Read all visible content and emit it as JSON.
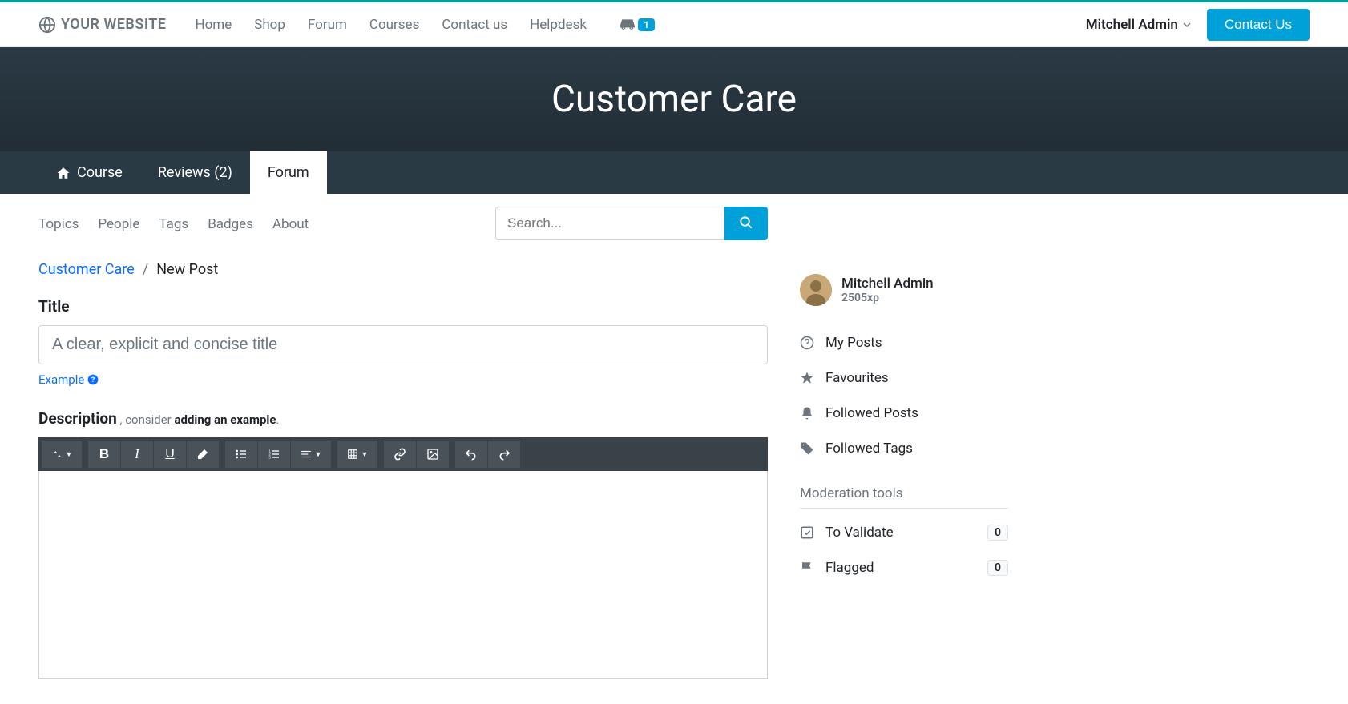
{
  "header": {
    "logo_text": "YOUR WEBSITE",
    "nav": [
      "Home",
      "Shop",
      "Forum",
      "Courses",
      "Contact us",
      "Helpdesk"
    ],
    "cart_count": "1",
    "user_name": "Mitchell Admin",
    "contact_btn": "Contact Us"
  },
  "hero": {
    "title": "Customer Care"
  },
  "subtabs": {
    "course": "Course",
    "reviews": "Reviews (2)",
    "forum": "Forum"
  },
  "forum_nav": [
    "Topics",
    "People",
    "Tags",
    "Badges",
    "About"
  ],
  "search": {
    "placeholder": "Search..."
  },
  "breadcrumb": {
    "parent": "Customer Care",
    "current": "New Post"
  },
  "form": {
    "title_label": "Title",
    "title_placeholder": "A clear, explicit and concise title",
    "example_link": "Example",
    "desc_label": "Description",
    "desc_hint_prefix": " , consider ",
    "desc_hint_strong": "adding an example",
    "desc_hint_suffix": "."
  },
  "sidebar": {
    "user_name": "Mitchell Admin",
    "user_xp": "2505xp",
    "links": {
      "my_posts": "My Posts",
      "favourites": "Favourites",
      "followed_posts": "Followed Posts",
      "followed_tags": "Followed Tags"
    },
    "mod_title": "Moderation tools",
    "mod": {
      "to_validate": "To Validate",
      "to_validate_count": "0",
      "flagged": "Flagged",
      "flagged_count": "0"
    }
  }
}
